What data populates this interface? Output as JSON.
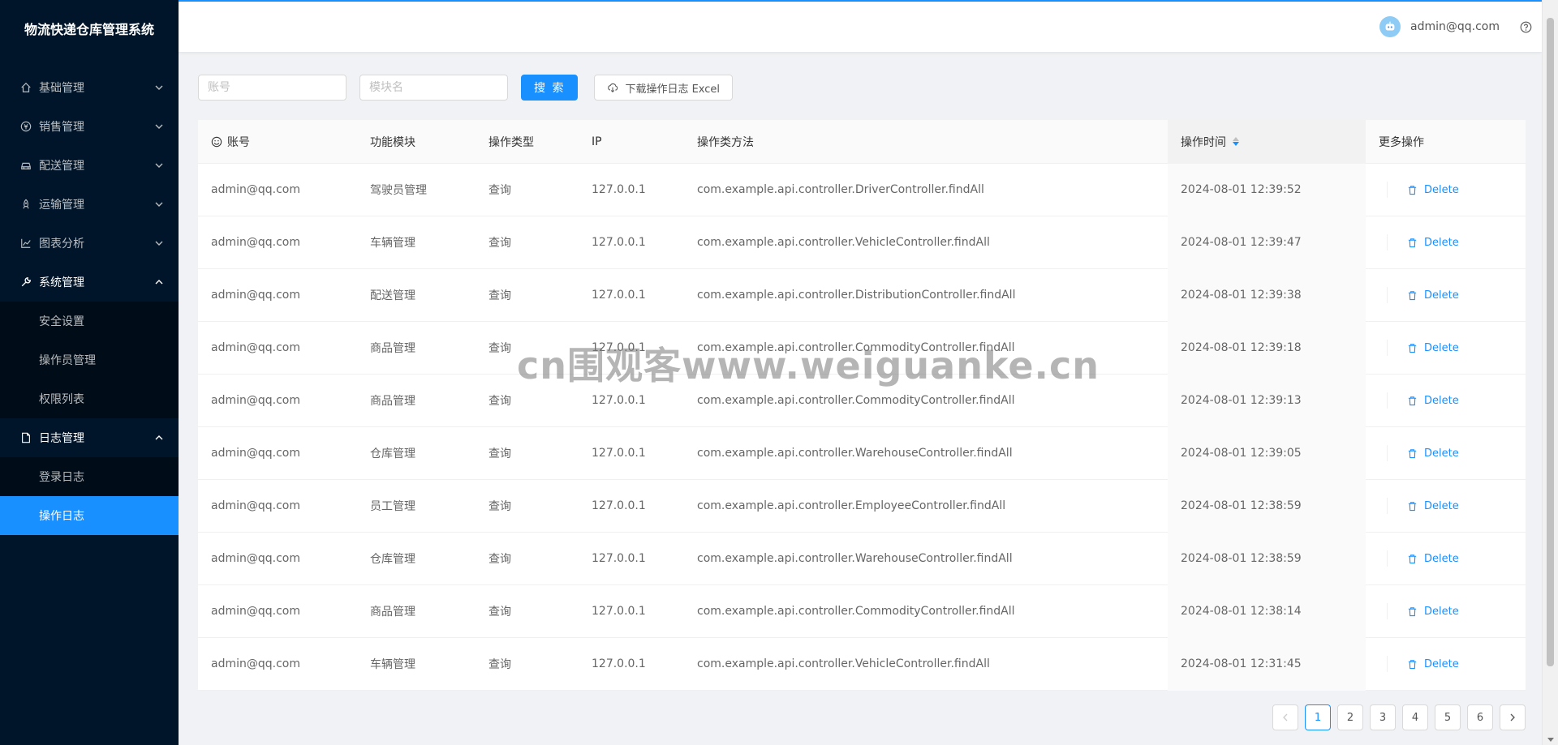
{
  "app": {
    "title": "物流快递仓库管理系统"
  },
  "sidebar": {
    "items": [
      {
        "label": "基础管理",
        "icon": "home-icon",
        "open": false
      },
      {
        "label": "销售管理",
        "icon": "money-icon",
        "open": false
      },
      {
        "label": "配送管理",
        "icon": "car-icon",
        "open": false
      },
      {
        "label": "运输管理",
        "icon": "rocket-icon",
        "open": false
      },
      {
        "label": "图表分析",
        "icon": "chart-icon",
        "open": false
      },
      {
        "label": "系统管理",
        "icon": "tool-icon",
        "open": true,
        "children": [
          "安全设置",
          "操作员管理",
          "权限列表"
        ]
      },
      {
        "label": "日志管理",
        "icon": "file-icon",
        "open": true,
        "children": [
          "登录日志",
          "操作日志"
        ],
        "active_child": "操作日志"
      }
    ]
  },
  "header": {
    "user": "admin@qq.com"
  },
  "toolbar": {
    "account_placeholder": "账号",
    "module_placeholder": "模块名",
    "search_label": "搜 索",
    "download_label": "下载操作日志 Excel"
  },
  "table": {
    "columns": [
      "账号",
      "功能模块",
      "操作类型",
      "IP",
      "操作类方法",
      "操作时间",
      "更多操作"
    ],
    "delete_label": "Delete",
    "rows": [
      {
        "account": "admin@qq.com",
        "module": "驾驶员管理",
        "type": "查询",
        "ip": "127.0.0.1",
        "method": "com.example.api.controller.DriverController.findAll",
        "time": "2024-08-01 12:39:52"
      },
      {
        "account": "admin@qq.com",
        "module": "车辆管理",
        "type": "查询",
        "ip": "127.0.0.1",
        "method": "com.example.api.controller.VehicleController.findAll",
        "time": "2024-08-01 12:39:47"
      },
      {
        "account": "admin@qq.com",
        "module": "配送管理",
        "type": "查询",
        "ip": "127.0.0.1",
        "method": "com.example.api.controller.DistributionController.findAll",
        "time": "2024-08-01 12:39:38"
      },
      {
        "account": "admin@qq.com",
        "module": "商品管理",
        "type": "查询",
        "ip": "127.0.0.1",
        "method": "com.example.api.controller.CommodityController.findAll",
        "time": "2024-08-01 12:39:18"
      },
      {
        "account": "admin@qq.com",
        "module": "商品管理",
        "type": "查询",
        "ip": "127.0.0.1",
        "method": "com.example.api.controller.CommodityController.findAll",
        "time": "2024-08-01 12:39:13"
      },
      {
        "account": "admin@qq.com",
        "module": "仓库管理",
        "type": "查询",
        "ip": "127.0.0.1",
        "method": "com.example.api.controller.WarehouseController.findAll",
        "time": "2024-08-01 12:39:05"
      },
      {
        "account": "admin@qq.com",
        "module": "员工管理",
        "type": "查询",
        "ip": "127.0.0.1",
        "method": "com.example.api.controller.EmployeeController.findAll",
        "time": "2024-08-01 12:38:59"
      },
      {
        "account": "admin@qq.com",
        "module": "仓库管理",
        "type": "查询",
        "ip": "127.0.0.1",
        "method": "com.example.api.controller.WarehouseController.findAll",
        "time": "2024-08-01 12:38:59"
      },
      {
        "account": "admin@qq.com",
        "module": "商品管理",
        "type": "查询",
        "ip": "127.0.0.1",
        "method": "com.example.api.controller.CommodityController.findAll",
        "time": "2024-08-01 12:38:14"
      },
      {
        "account": "admin@qq.com",
        "module": "车辆管理",
        "type": "查询",
        "ip": "127.0.0.1",
        "method": "com.example.api.controller.VehicleController.findAll",
        "time": "2024-08-01 12:31:45"
      }
    ]
  },
  "pagination": {
    "pages": [
      "1",
      "2",
      "3",
      "4",
      "5",
      "6"
    ],
    "current": "1"
  },
  "watermark": "cn围观客www.weiguanke.cn",
  "colors": {
    "sidebar_bg": "#001529",
    "submenu_bg": "#000c17",
    "primary": "#1890ff"
  }
}
